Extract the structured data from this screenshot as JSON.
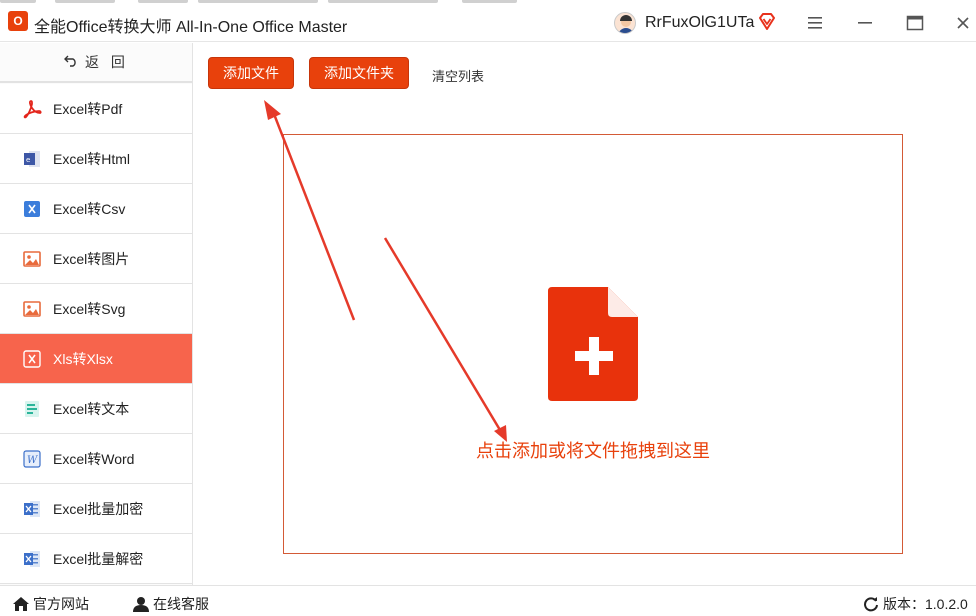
{
  "window": {
    "app_title": "全能Office转换大师 All-In-One Office Master",
    "username": "RrFuxOlG1UTa",
    "icons": {
      "logo": "app-logo-icon",
      "avatar": "avatar",
      "vip": "diamond-icon",
      "menu": "hamburger-menu-icon",
      "minimize": "minimize-icon",
      "maximize": "maximize-icon",
      "close": "close-icon"
    }
  },
  "sidebar": {
    "back_label": "返 回",
    "items": [
      {
        "label": "Excel转Pdf",
        "icon": "pdf-icon",
        "active": false
      },
      {
        "label": "Excel转Html",
        "icon": "html-icon",
        "active": false
      },
      {
        "label": "Excel转Csv",
        "icon": "csv-icon",
        "active": false
      },
      {
        "label": "Excel转图片",
        "icon": "image-icon",
        "active": false
      },
      {
        "label": "Excel转Svg",
        "icon": "svg-image-icon",
        "active": false
      },
      {
        "label": "Xls转Xlsx",
        "icon": "xlsx-icon",
        "active": true
      },
      {
        "label": "Excel转文本",
        "icon": "text-doc-icon",
        "active": false
      },
      {
        "label": "Excel转Word",
        "icon": "word-icon",
        "active": false
      },
      {
        "label": "Excel批量加密",
        "icon": "excel-lock-icon",
        "active": false
      },
      {
        "label": "Excel批量解密",
        "icon": "excel-unlock-icon",
        "active": false
      }
    ]
  },
  "toolbar": {
    "add_file_label": "添加文件",
    "add_folder_label": "添加文件夹",
    "clear_list_label": "清空列表"
  },
  "dropzone": {
    "hint": "点击添加或将文件拖拽到这里",
    "icon": "add-file-icon"
  },
  "statusbar": {
    "site_label": "官方网站",
    "service_label": "在线客服",
    "version_label": "版本：1.0.2.0"
  },
  "colors": {
    "accent": "#e8410c",
    "active_nav": "#f7644c",
    "dropzone_border": "#d35a36",
    "annotation_arrow": "#e53a2a"
  }
}
